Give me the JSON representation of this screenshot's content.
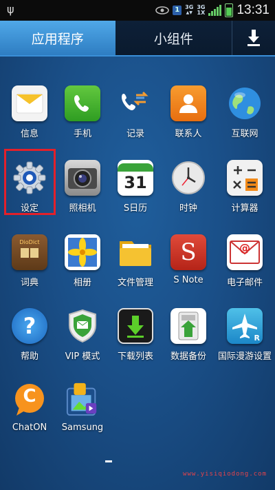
{
  "status_bar": {
    "usb": "ψ",
    "sim_badge": "1",
    "net_3g_top": "3G",
    "net_3g_bottom": "3G",
    "net_sub": "1X",
    "time": "13:31"
  },
  "tabs": {
    "apps": "应用程序",
    "widgets": "小组件",
    "download": "⬇"
  },
  "apps": [
    {
      "label": "信息",
      "icon": "message-icon"
    },
    {
      "label": "手机",
      "icon": "phone-icon"
    },
    {
      "label": "记录",
      "icon": "call-log-icon"
    },
    {
      "label": "联系人",
      "icon": "contacts-icon"
    },
    {
      "label": "互联网",
      "icon": "globe-icon"
    },
    {
      "label": "设定",
      "icon": "gear-icon"
    },
    {
      "label": "照相机",
      "icon": "camera-icon"
    },
    {
      "label": "S日历",
      "icon": "calendar-icon",
      "glyph": "31"
    },
    {
      "label": "时钟",
      "icon": "clock-icon"
    },
    {
      "label": "计算器",
      "icon": "calculator-icon"
    },
    {
      "label": "词典",
      "icon": "dictionary-icon",
      "glyph": "DioDict"
    },
    {
      "label": "相册",
      "icon": "gallery-icon"
    },
    {
      "label": "文件管理",
      "icon": "folder-icon"
    },
    {
      "label": "S Note",
      "icon": "snote-icon",
      "glyph": "S"
    },
    {
      "label": "电子邮件",
      "icon": "email-icon",
      "glyph": "@"
    },
    {
      "label": "帮助",
      "icon": "help-icon",
      "glyph": "?"
    },
    {
      "label": "VIP 模式",
      "icon": "vip-shield-icon"
    },
    {
      "label": "下载列表",
      "icon": "download-list-icon"
    },
    {
      "label": "数据备份",
      "icon": "backup-icon"
    },
    {
      "label": "国际漫游设置",
      "icon": "roaming-plane-icon",
      "glyph": "R"
    },
    {
      "label": "ChatON",
      "icon": "chaton-icon",
      "glyph": "C"
    },
    {
      "label": "Samsung",
      "icon": "samsung-apps-icon"
    }
  ],
  "watermark": "www.yisiqiodong.com"
}
